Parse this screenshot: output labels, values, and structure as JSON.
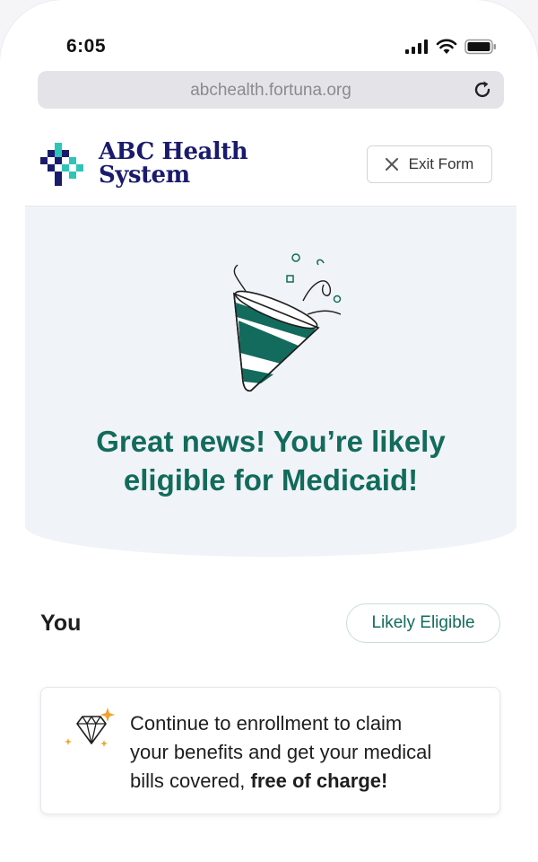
{
  "status_bar": {
    "time": "6:05",
    "icons": [
      "cellular-signal-icon",
      "wifi-icon",
      "battery-icon"
    ]
  },
  "browser": {
    "url": "abchealth.fortuna.org",
    "reload_icon": "reload-icon"
  },
  "header": {
    "logo_line1": "ABC Health",
    "logo_line2": "System",
    "exit_label": "Exit Form",
    "exit_icon": "close-icon"
  },
  "hero": {
    "illustration": "party-popper-icon",
    "headline_line1": "Great news! You’re likely",
    "headline_line2": "eligible for Medicaid!"
  },
  "eligibility": {
    "person_label": "You",
    "status_label": "Likely Eligible"
  },
  "info_card": {
    "icon": "diamond-sparkle-icon",
    "text_line1": "Continue to enrollment to claim",
    "text_line2": "your benefits and get your medical",
    "text_line3_plain": "bills covered,",
    "text_line3_bold": "free of charge!"
  },
  "colors": {
    "brand_navy": "#1b1b6e",
    "brand_teal": "#2ec4b6",
    "accent_green": "#126b5c",
    "hero_bg": "#f0f3f7",
    "sparkle_orange": "#f2a030"
  }
}
